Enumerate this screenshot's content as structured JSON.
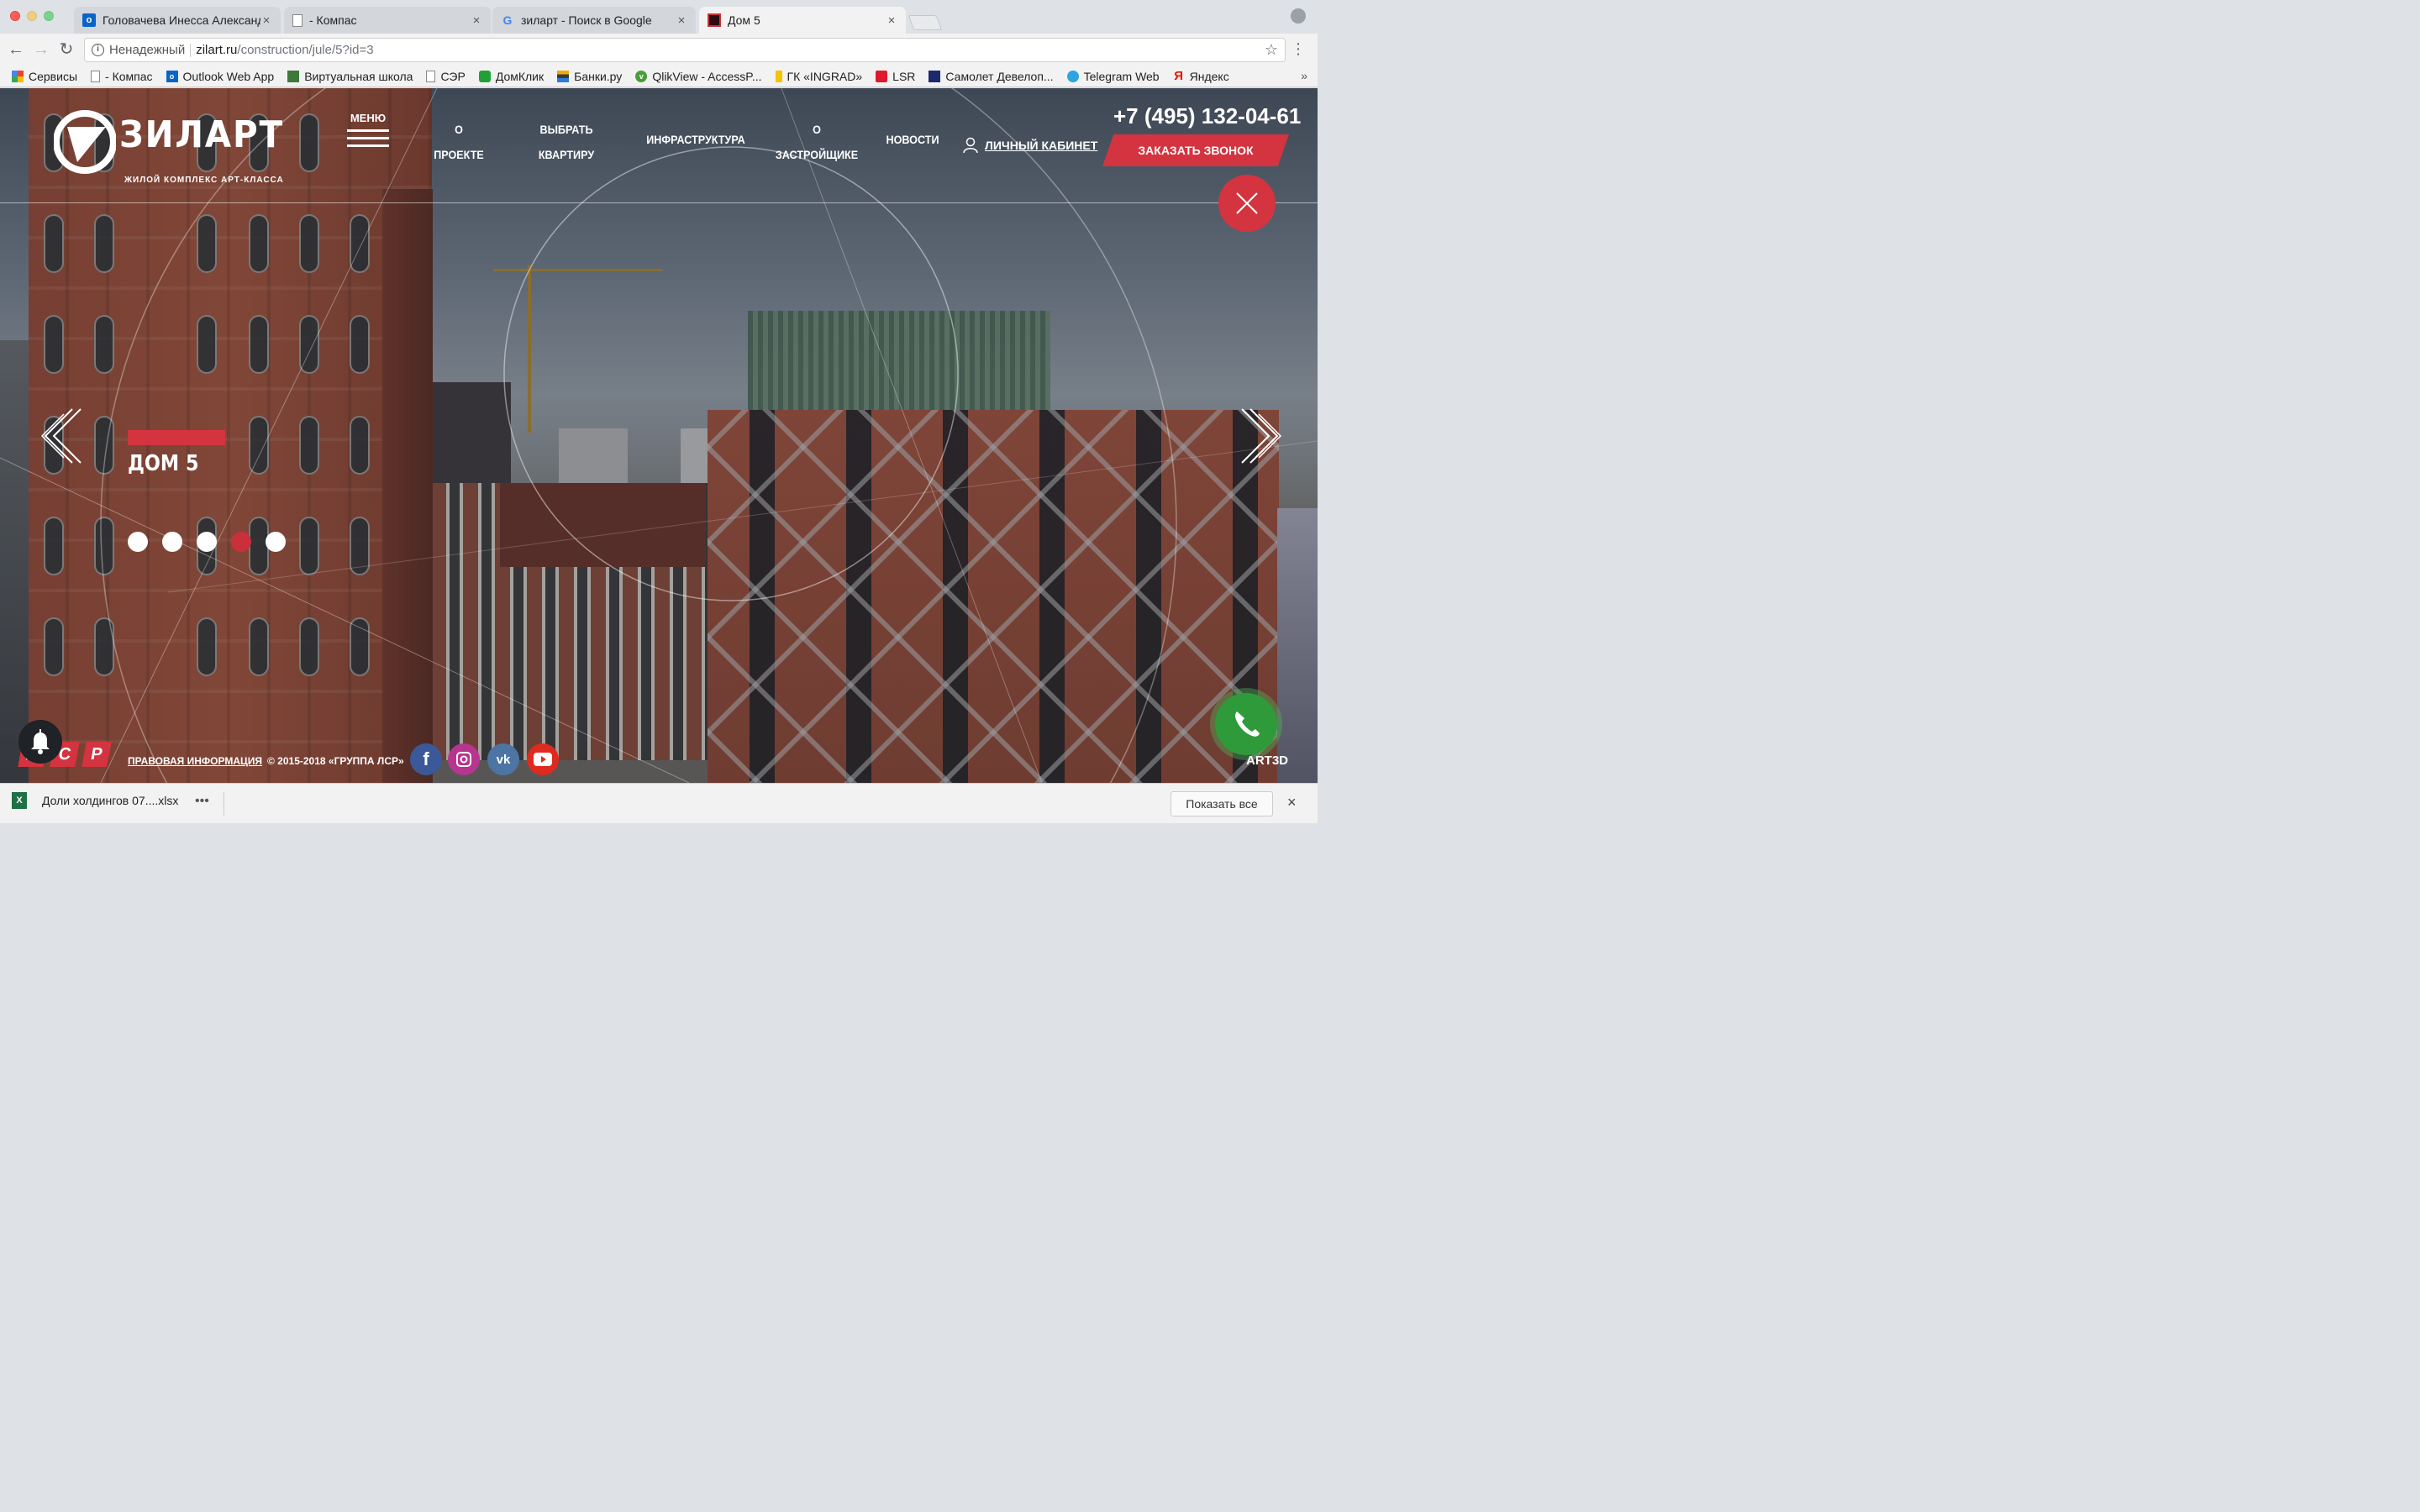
{
  "browser": {
    "tabs": [
      {
        "title": "Головачева Инесса Александ",
        "close": "×"
      },
      {
        "title": "- Компас",
        "close": "×"
      },
      {
        "title": "зиларт - Поиск в Google",
        "close": "×"
      },
      {
        "title": "Дом 5",
        "close": "×"
      }
    ],
    "address": {
      "security": "Ненадежный",
      "host": "zilart.ru",
      "path": "/construction/jule/5?id=3"
    },
    "bookmarks": [
      "Сервисы",
      "- Компас",
      "Outlook Web App",
      "Виртуальная школа",
      "СЭР",
      "ДомКлик",
      "Банки.ру",
      "QlikView - AccessP...",
      "ГК «INGRAD»",
      "LSR",
      "Самолет Девелоп...",
      "Telegram Web",
      "Яндекс"
    ],
    "bookmarks_more": "»"
  },
  "site": {
    "logo": {
      "word": "ЗИЛАРТ",
      "subtitle": "ЖИЛОЙ КОМПЛЕКС АРТ-КЛАССА"
    },
    "menu_label": "МЕНЮ",
    "nav": [
      {
        "line1": "О",
        "line2": "ПРОЕКТЕ"
      },
      {
        "line1": "ВЫБРАТЬ",
        "line2": "КВАРТИРУ"
      },
      {
        "line1": "ИНФРАСТРУКТУРА",
        "line2": ""
      },
      {
        "line1": "О",
        "line2": "ЗАСТРОЙЩИКЕ"
      },
      {
        "line1": "НОВОСТИ",
        "line2": ""
      }
    ],
    "account_label": "ЛИЧНЫЙ КАБИНЕТ",
    "phone": "+7 (495) 132-04-61",
    "callback_label": "ЗАКАЗАТЬ ЗВОНОК",
    "slide": {
      "title": "ДОМ 5",
      "dots": 5,
      "active_dot": 4
    },
    "footer": {
      "lsr_letters": [
        "Л",
        "С",
        "Р"
      ],
      "legal": "ПРАВОВАЯ ИНФОРМАЦИЯ",
      "copyright": "© 2015-2018 «ГРУППА ЛСР»",
      "social": [
        "facebook",
        "instagram",
        "vk",
        "youtube"
      ],
      "widget_label": "ART3D"
    },
    "colors": {
      "accent": "#d3343f",
      "phone_widget": "#2f9a3a"
    }
  },
  "downloads": {
    "file": "Доли холдингов 07....xlsx",
    "file_icon_label": "X",
    "more": "•••",
    "show_all": "Показать все",
    "close": "×"
  }
}
